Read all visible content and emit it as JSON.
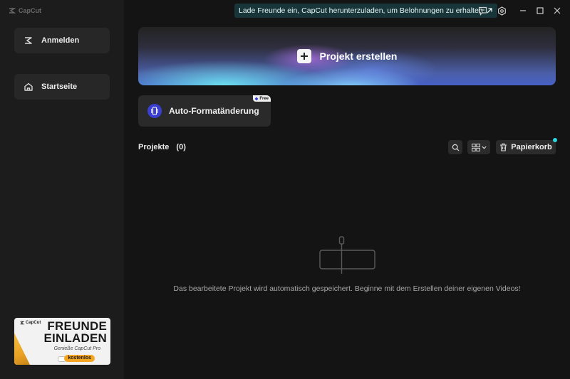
{
  "app": {
    "name": "CapCut"
  },
  "sidebar": {
    "login_label": "Anmelden",
    "home_label": "Startseite",
    "promo": {
      "brand": "CapCut",
      "line1": "FREUNDE",
      "line2": "EINLADEN",
      "subtitle": "Genieße CapCut Pro",
      "badge": "kostenlos"
    }
  },
  "topbar": {
    "invite_text": "Lade Freunde ein, CapCut herunterzuladen, um Belohnungen zu erhalten",
    "icons": [
      "feedback-icon",
      "settings-icon",
      "minimize-icon",
      "maximize-icon",
      "close-icon"
    ]
  },
  "main": {
    "create_label": "Projekt erstellen",
    "auto_format_label": "Auto-Formatänderung",
    "free_badge": "Free",
    "projects_label": "Projekte",
    "projects_count": "(0)",
    "trash_label": "Papierkorb",
    "empty_message": "Das bearbeitete Projekt wird automatisch gespeichert. Beginne mit dem Erstellen deiner eigenen Videos!"
  },
  "colors": {
    "background": "#141414",
    "sidebar": "#1c1c1c",
    "accent_cyan": "#2fd5e0",
    "invite_bg": "#18363a"
  }
}
